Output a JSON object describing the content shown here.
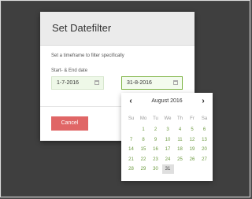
{
  "modal": {
    "title": "Set Datefilter",
    "helper_text": "Set a timeframe to filter specifically",
    "field_label": "Start- & End date",
    "start_date": "1-7-2016",
    "end_date": "31-8-2016",
    "cancel_label": "Cancel"
  },
  "datepicker": {
    "month_label": "August 2016",
    "prev_icon": "chevron-left-icon",
    "next_icon": "chevron-right-icon",
    "weekdays": [
      "Su",
      "Mo",
      "Tu",
      "We",
      "Th",
      "Fr",
      "Sa"
    ],
    "weeks": [
      [
        "",
        "1",
        "2",
        "3",
        "4",
        "5",
        "6"
      ],
      [
        "7",
        "8",
        "9",
        "10",
        "11",
        "12",
        "13"
      ],
      [
        "14",
        "15",
        "16",
        "17",
        "18",
        "19",
        "20"
      ],
      [
        "21",
        "22",
        "23",
        "24",
        "25",
        "26",
        "27"
      ],
      [
        "28",
        "29",
        "30",
        "31",
        "",
        "",
        ""
      ]
    ],
    "selected_day": "31"
  },
  "colors": {
    "backdrop": "#3f3f3f",
    "cancel_button": "#e06666",
    "day_text": "#6c9a3f",
    "input_background": "#eef8e8",
    "active_border": "#7cb342"
  }
}
